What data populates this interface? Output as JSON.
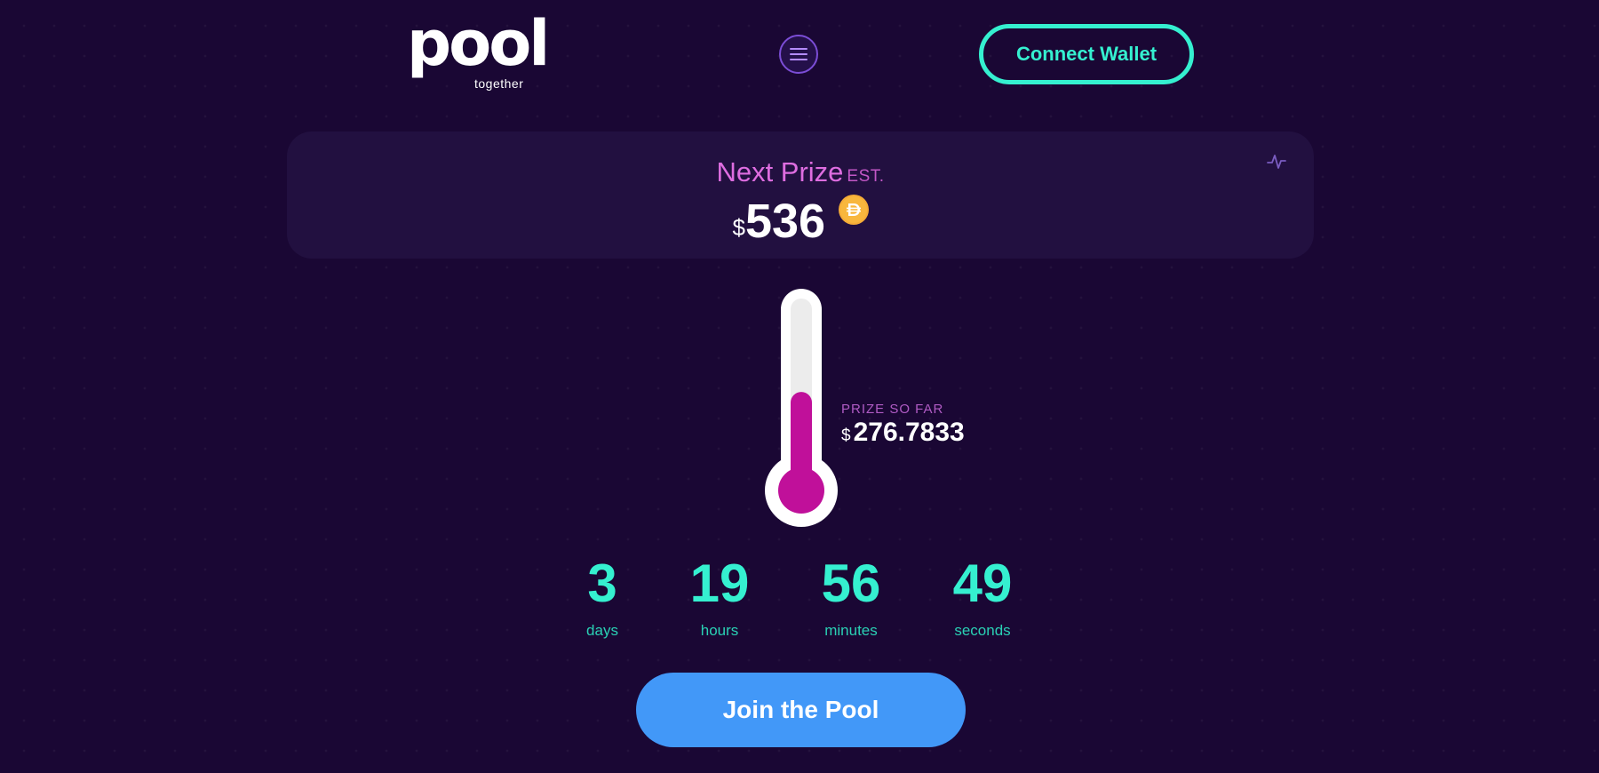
{
  "header": {
    "logo_word": "pool",
    "logo_sub": "together",
    "menu_icon": "hamburger-menu-icon",
    "connect_label": "Connect Wallet"
  },
  "prize": {
    "title": "Next Prize",
    "est": "EST.",
    "currency": "$",
    "amount": "536",
    "token_icon": "dai-coin-icon",
    "activity_icon": "activity-pulse-icon"
  },
  "progress": {
    "label": "PRIZE SO FAR",
    "currency": "$",
    "amount": "276.7833",
    "fill_fraction": 0.52
  },
  "countdown": [
    {
      "value": "3",
      "label": "days"
    },
    {
      "value": "19",
      "label": "hours"
    },
    {
      "value": "56",
      "label": "minutes"
    },
    {
      "value": "49",
      "label": "seconds"
    }
  ],
  "cta": {
    "join_label": "Join the Pool"
  },
  "colors": {
    "background": "#1a0734",
    "accent_teal": "#35f0d0",
    "prize_pink": "#de6de0",
    "thermo_fill": "#c0109a",
    "button_blue": "#4298f8"
  }
}
